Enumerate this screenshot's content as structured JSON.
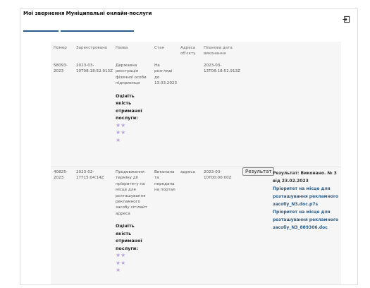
{
  "tabs": [
    {
      "label": "Мої звернення"
    },
    {
      "label": "Муніципальні онлайн-послуги"
    }
  ],
  "logout_icon": "logout-icon",
  "table": {
    "headers": [
      "Номер",
      "Зареєстровано",
      "Назва",
      "Стан",
      "Адреса об'єкту",
      "Планова дата виконання",
      "",
      ""
    ],
    "rows": [
      {
        "number": "58093-2023",
        "registered": "2023-03-10T08:18:52.913Z",
        "name": "Державна реєстрація фізичної особи підприємця",
        "status": "На розгляді до 13.03.2023",
        "address": "",
        "planned_date": "2023-03-13T08:18:52.913Z",
        "rate_label": "Оцініть якість отриманої послуги:",
        "stars": [
          "★★",
          "★★",
          "★"
        ]
      },
      {
        "number": "40825-2023",
        "registered": "2023-02-17T15:04:14Z",
        "name": "Продовження терміну дії пріоритету на місце для розташування рекламного засобу сітілайт адреса",
        "status": "Виконана та передана на портал",
        "address": "адреса",
        "planned_date": "2023-03-10T00:00:00Z",
        "result_button": "Результат",
        "result_title": "Результат: Виконано. № 3 від 23.02.2023",
        "result_links": [
          "Пріоритет на місце для розташування рекламного засобу_N3.doc.p7s",
          "Пріоритет на місце для розташування рекламного засобу_N3_889306.doc"
        ],
        "rate_label": "Оцініть якість отриманої послуги:",
        "stars": [
          "★★",
          "★★",
          "★"
        ]
      }
    ]
  },
  "colors": {
    "accent": "#2e5c8a",
    "star": "#b9a6d8",
    "link": "#2c5d89"
  }
}
